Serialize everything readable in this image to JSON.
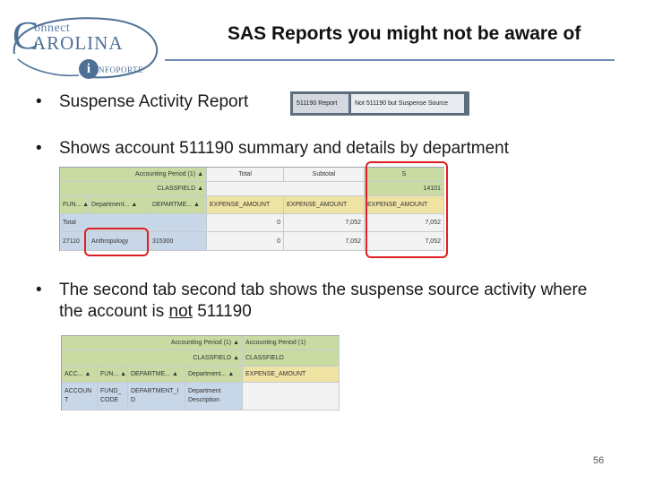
{
  "logo": {
    "line1": "onnect",
    "big_c": "C",
    "line2": "AROLINA",
    "badge": "i",
    "line3": "NFOPORTE"
  },
  "title": "SAS Reports you might not be aware of",
  "bullets": {
    "b1": "Suspense Activity Report",
    "b2": "Shows account 511190 summary and details by department",
    "b3_pre": "The second tab second tab shows the suspense source activity where the account is ",
    "b3_ul": "not",
    "b3_post": " 511190"
  },
  "tabs": [
    "511190 Report",
    "Not 511190 but Suspense Source"
  ],
  "report1": {
    "r1": {
      "label": "Accounting Period (1) ▲",
      "total": "Total",
      "subtotal": "Subtotal",
      "s": "S",
      "s2": "S"
    },
    "r2": {
      "label": "CLASSFIELD ▲",
      "val": "14101"
    },
    "r3": {
      "h1": "FUN... ▲",
      "h2": "Department... ▲",
      "h3": "DEPARTME... ▲",
      "h4": "EXPENSE_AMOUNT",
      "h5": "EXPENSE_AMOUNT",
      "h6": "EXPENSE_AMOUNT"
    },
    "r4": {
      "label": "Total",
      "v1": "0",
      "v2": "7,052",
      "v3": "7,052"
    },
    "r5": {
      "fund": "27110",
      "dept": "Anthropology",
      "deptid": "315300",
      "v1": "0",
      "v2": "7,052",
      "v3": "7,052"
    }
  },
  "report2": {
    "r1": {
      "label": "Accounting Period (1) ▲",
      "val": "Accounting Period (1)"
    },
    "r2": {
      "label": "CLASSFIELD ▲",
      "val": "CLASSFIELD"
    },
    "r3": {
      "h1": "ACC... ▲",
      "h2": "FUN... ▲",
      "h3": "DEPARTME... ▲",
      "h4": "Department... ▲",
      "h5": "EXPENSE_AMOUNT"
    },
    "r4": {
      "c1": "ACCOUNT",
      "c2": "FUND_CODE",
      "c3": "DEPARTMENT_ID",
      "c4": "Department Description"
    }
  },
  "page_number": "56",
  "colors": {
    "title_rule": "#6f8db8",
    "highlight": "#e02020",
    "header_green": "#c9dba3",
    "header_yellow": "#efe3a4",
    "row_blue": "#c8d7e8"
  }
}
